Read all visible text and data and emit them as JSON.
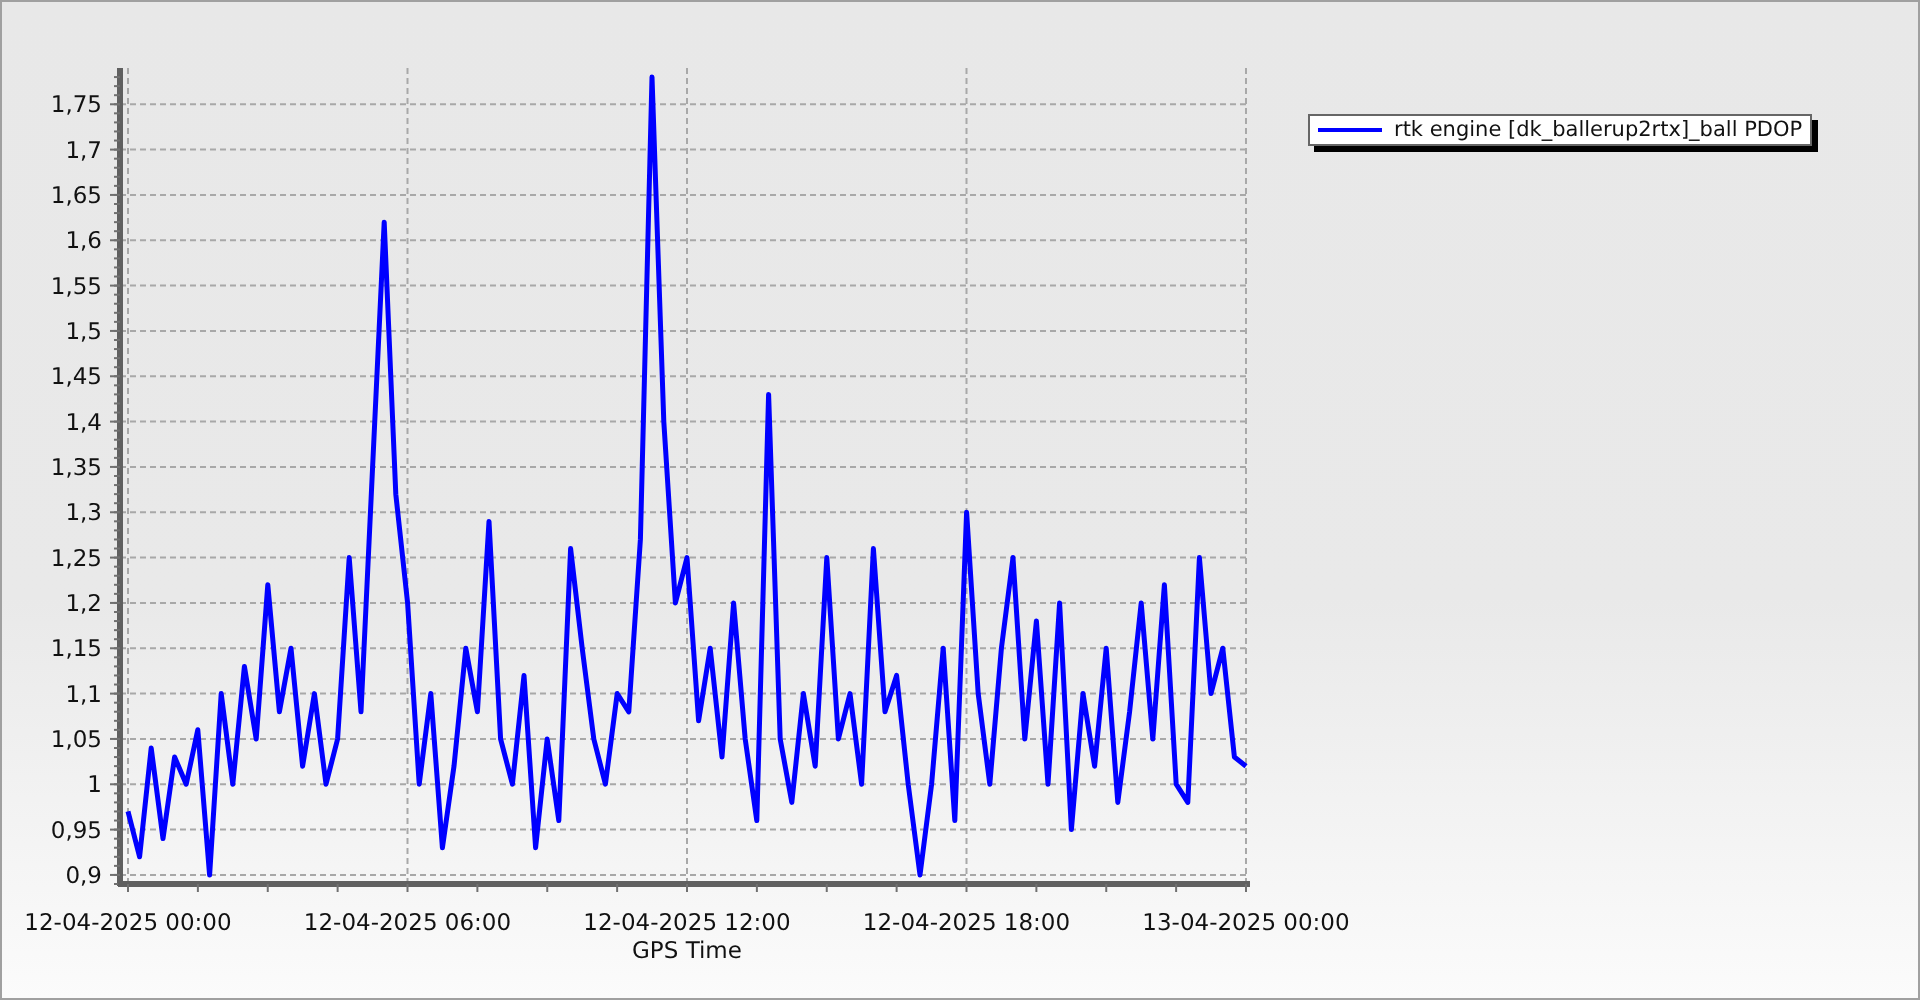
{
  "chart": {
    "chart_data": {
      "type": "line",
      "xlabel": "GPS Time",
      "grid": true,
      "ylim": [
        0.89,
        1.79
      ],
      "yticks": [
        {
          "value": 0.9,
          "label": "0,9"
        },
        {
          "value": 0.95,
          "label": "0,95"
        },
        {
          "value": 1,
          "label": "1"
        },
        {
          "value": 1.05,
          "label": "1,05"
        },
        {
          "value": 1.1,
          "label": "1,1"
        },
        {
          "value": 1.15,
          "label": "1,15"
        },
        {
          "value": 1.2,
          "label": "1,2"
        },
        {
          "value": 1.25,
          "label": "1,25"
        },
        {
          "value": 1.3,
          "label": "1,3"
        },
        {
          "value": 1.35,
          "label": "1,35"
        },
        {
          "value": 1.4,
          "label": "1,4"
        },
        {
          "value": 1.45,
          "label": "1,45"
        },
        {
          "value": 1.5,
          "label": "1,5"
        },
        {
          "value": 1.55,
          "label": "1,55"
        },
        {
          "value": 1.6,
          "label": "1,6"
        },
        {
          "value": 1.65,
          "label": "1,65"
        },
        {
          "value": 1.7,
          "label": "1,7"
        },
        {
          "value": 1.75,
          "label": "1,75"
        }
      ],
      "categories": [
        "12-04-2025 00:00",
        null,
        null,
        null,
        null,
        null,
        null,
        null,
        null,
        null,
        null,
        null,
        null,
        null,
        null,
        null,
        null,
        null,
        null,
        null,
        null,
        null,
        null,
        null,
        "12-04-2025 06:00",
        null,
        null,
        null,
        null,
        null,
        null,
        null,
        null,
        null,
        null,
        null,
        null,
        null,
        null,
        null,
        null,
        null,
        null,
        null,
        null,
        null,
        null,
        null,
        "12-04-2025 12:00",
        null,
        null,
        null,
        null,
        null,
        null,
        null,
        null,
        null,
        null,
        null,
        null,
        null,
        null,
        null,
        null,
        null,
        null,
        null,
        null,
        null,
        null,
        null,
        "12-04-2025 18:00",
        null,
        null,
        null,
        null,
        null,
        null,
        null,
        null,
        null,
        null,
        null,
        null,
        null,
        null,
        null,
        null,
        null,
        null,
        null,
        null,
        null,
        null,
        null,
        "13-04-2025 00:00"
      ],
      "series": [
        {
          "name": "rtk engine [dk_ballerup2rtx]_ball PDOP",
          "color": "#0000ff",
          "values": [
            0.97,
            0.92,
            1.04,
            0.94,
            1.03,
            1.0,
            1.06,
            0.9,
            1.1,
            1.0,
            1.13,
            1.05,
            1.22,
            1.08,
            1.15,
            1.02,
            1.1,
            1.0,
            1.05,
            1.25,
            1.08,
            1.35,
            1.62,
            1.32,
            1.2,
            1.0,
            1.1,
            0.93,
            1.02,
            1.15,
            1.08,
            1.29,
            1.05,
            1.0,
            1.12,
            0.93,
            1.05,
            0.96,
            1.26,
            1.15,
            1.05,
            1.0,
            1.1,
            1.08,
            1.27,
            1.78,
            1.4,
            1.2,
            1.25,
            1.07,
            1.15,
            1.03,
            1.2,
            1.05,
            0.96,
            1.43,
            1.05,
            0.98,
            1.1,
            1.02,
            1.25,
            1.05,
            1.1,
            1.0,
            1.26,
            1.08,
            1.12,
            1.0,
            0.9,
            1.0,
            1.15,
            0.96,
            1.3,
            1.1,
            1.0,
            1.15,
            1.25,
            1.05,
            1.18,
            1.0,
            1.2,
            0.95,
            1.1,
            1.02,
            1.15,
            0.98,
            1.08,
            1.2,
            1.05,
            1.22,
            1.0,
            0.98,
            1.25,
            1.1,
            1.15,
            1.03,
            1.02
          ]
        }
      ]
    }
  }
}
